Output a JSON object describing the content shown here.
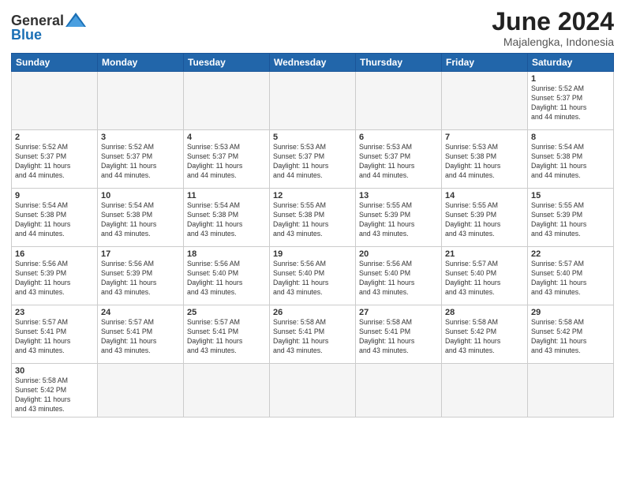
{
  "header": {
    "logo": {
      "general": "General",
      "blue": "Blue"
    },
    "title": "June 2024",
    "subtitle": "Majalengka, Indonesia"
  },
  "weekdays": [
    "Sunday",
    "Monday",
    "Tuesday",
    "Wednesday",
    "Thursday",
    "Friday",
    "Saturday"
  ],
  "weeks": [
    [
      {
        "day": null,
        "info": null
      },
      {
        "day": null,
        "info": null
      },
      {
        "day": null,
        "info": null
      },
      {
        "day": null,
        "info": null
      },
      {
        "day": null,
        "info": null
      },
      {
        "day": null,
        "info": null
      },
      {
        "day": "1",
        "info": "Sunrise: 5:52 AM\nSunset: 5:37 PM\nDaylight: 11 hours\nand 44 minutes."
      }
    ],
    [
      {
        "day": "2",
        "info": "Sunrise: 5:52 AM\nSunset: 5:37 PM\nDaylight: 11 hours\nand 44 minutes."
      },
      {
        "day": "3",
        "info": "Sunrise: 5:52 AM\nSunset: 5:37 PM\nDaylight: 11 hours\nand 44 minutes."
      },
      {
        "day": "4",
        "info": "Sunrise: 5:53 AM\nSunset: 5:37 PM\nDaylight: 11 hours\nand 44 minutes."
      },
      {
        "day": "5",
        "info": "Sunrise: 5:53 AM\nSunset: 5:37 PM\nDaylight: 11 hours\nand 44 minutes."
      },
      {
        "day": "6",
        "info": "Sunrise: 5:53 AM\nSunset: 5:37 PM\nDaylight: 11 hours\nand 44 minutes."
      },
      {
        "day": "7",
        "info": "Sunrise: 5:53 AM\nSunset: 5:38 PM\nDaylight: 11 hours\nand 44 minutes."
      },
      {
        "day": "8",
        "info": "Sunrise: 5:54 AM\nSunset: 5:38 PM\nDaylight: 11 hours\nand 44 minutes."
      }
    ],
    [
      {
        "day": "9",
        "info": "Sunrise: 5:54 AM\nSunset: 5:38 PM\nDaylight: 11 hours\nand 44 minutes."
      },
      {
        "day": "10",
        "info": "Sunrise: 5:54 AM\nSunset: 5:38 PM\nDaylight: 11 hours\nand 43 minutes."
      },
      {
        "day": "11",
        "info": "Sunrise: 5:54 AM\nSunset: 5:38 PM\nDaylight: 11 hours\nand 43 minutes."
      },
      {
        "day": "12",
        "info": "Sunrise: 5:55 AM\nSunset: 5:38 PM\nDaylight: 11 hours\nand 43 minutes."
      },
      {
        "day": "13",
        "info": "Sunrise: 5:55 AM\nSunset: 5:39 PM\nDaylight: 11 hours\nand 43 minutes."
      },
      {
        "day": "14",
        "info": "Sunrise: 5:55 AM\nSunset: 5:39 PM\nDaylight: 11 hours\nand 43 minutes."
      },
      {
        "day": "15",
        "info": "Sunrise: 5:55 AM\nSunset: 5:39 PM\nDaylight: 11 hours\nand 43 minutes."
      }
    ],
    [
      {
        "day": "16",
        "info": "Sunrise: 5:56 AM\nSunset: 5:39 PM\nDaylight: 11 hours\nand 43 minutes."
      },
      {
        "day": "17",
        "info": "Sunrise: 5:56 AM\nSunset: 5:39 PM\nDaylight: 11 hours\nand 43 minutes."
      },
      {
        "day": "18",
        "info": "Sunrise: 5:56 AM\nSunset: 5:40 PM\nDaylight: 11 hours\nand 43 minutes."
      },
      {
        "day": "19",
        "info": "Sunrise: 5:56 AM\nSunset: 5:40 PM\nDaylight: 11 hours\nand 43 minutes."
      },
      {
        "day": "20",
        "info": "Sunrise: 5:56 AM\nSunset: 5:40 PM\nDaylight: 11 hours\nand 43 minutes."
      },
      {
        "day": "21",
        "info": "Sunrise: 5:57 AM\nSunset: 5:40 PM\nDaylight: 11 hours\nand 43 minutes."
      },
      {
        "day": "22",
        "info": "Sunrise: 5:57 AM\nSunset: 5:40 PM\nDaylight: 11 hours\nand 43 minutes."
      }
    ],
    [
      {
        "day": "23",
        "info": "Sunrise: 5:57 AM\nSunset: 5:41 PM\nDaylight: 11 hours\nand 43 minutes."
      },
      {
        "day": "24",
        "info": "Sunrise: 5:57 AM\nSunset: 5:41 PM\nDaylight: 11 hours\nand 43 minutes."
      },
      {
        "day": "25",
        "info": "Sunrise: 5:57 AM\nSunset: 5:41 PM\nDaylight: 11 hours\nand 43 minutes."
      },
      {
        "day": "26",
        "info": "Sunrise: 5:58 AM\nSunset: 5:41 PM\nDaylight: 11 hours\nand 43 minutes."
      },
      {
        "day": "27",
        "info": "Sunrise: 5:58 AM\nSunset: 5:41 PM\nDaylight: 11 hours\nand 43 minutes."
      },
      {
        "day": "28",
        "info": "Sunrise: 5:58 AM\nSunset: 5:42 PM\nDaylight: 11 hours\nand 43 minutes."
      },
      {
        "day": "29",
        "info": "Sunrise: 5:58 AM\nSunset: 5:42 PM\nDaylight: 11 hours\nand 43 minutes."
      }
    ],
    [
      {
        "day": "30",
        "info": "Sunrise: 5:58 AM\nSunset: 5:42 PM\nDaylight: 11 hours\nand 43 minutes."
      },
      {
        "day": null,
        "info": null
      },
      {
        "day": null,
        "info": null
      },
      {
        "day": null,
        "info": null
      },
      {
        "day": null,
        "info": null
      },
      {
        "day": null,
        "info": null
      },
      {
        "day": null,
        "info": null
      }
    ]
  ]
}
